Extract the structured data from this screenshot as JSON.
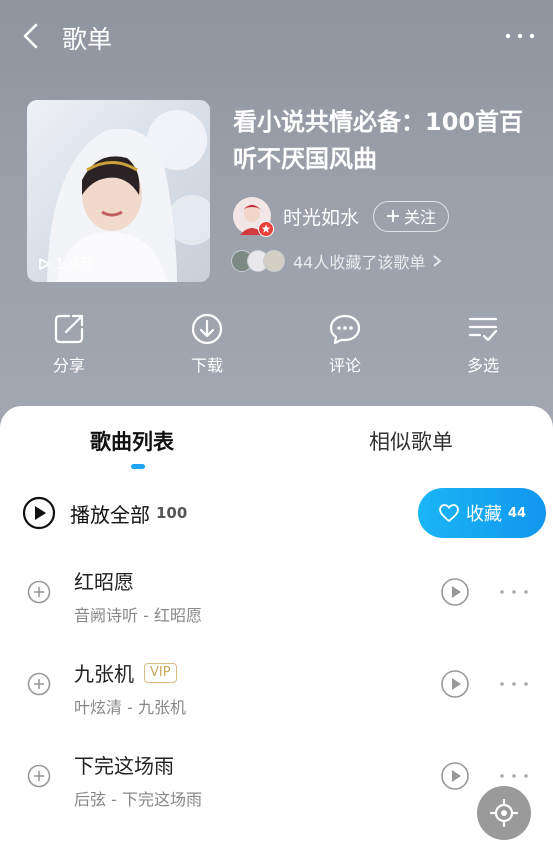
{
  "header": {
    "title": "歌单"
  },
  "playlist": {
    "title": "看小说共情必备：100首百听不厌国风曲",
    "play_count": "1.9万",
    "creator": "时光如水",
    "follow_label": "关注",
    "collectors_text": "44人收藏了该歌单"
  },
  "actions": [
    {
      "label": "分享",
      "icon": "share-icon"
    },
    {
      "label": "下载",
      "icon": "download-icon"
    },
    {
      "label": "评论",
      "icon": "comment-icon"
    },
    {
      "label": "多选",
      "icon": "multi-select-icon"
    }
  ],
  "tabs": [
    "歌曲列表",
    "相似歌单"
  ],
  "play_all": {
    "label": "播放全部",
    "count": "100"
  },
  "collect": {
    "label": "收藏",
    "count": "44"
  },
  "songs": [
    {
      "title": "红昭愿",
      "subtitle": "音阙诗听 - 红昭愿",
      "vip": ""
    },
    {
      "title": "九张机",
      "subtitle": "叶炫清 - 九张机",
      "vip": "VIP"
    },
    {
      "title": "下完这场雨",
      "subtitle": "后弦 - 下完这场雨",
      "vip": ""
    }
  ],
  "colors": {
    "accent": "#1fa5f5",
    "vip": "#c9a65a"
  }
}
